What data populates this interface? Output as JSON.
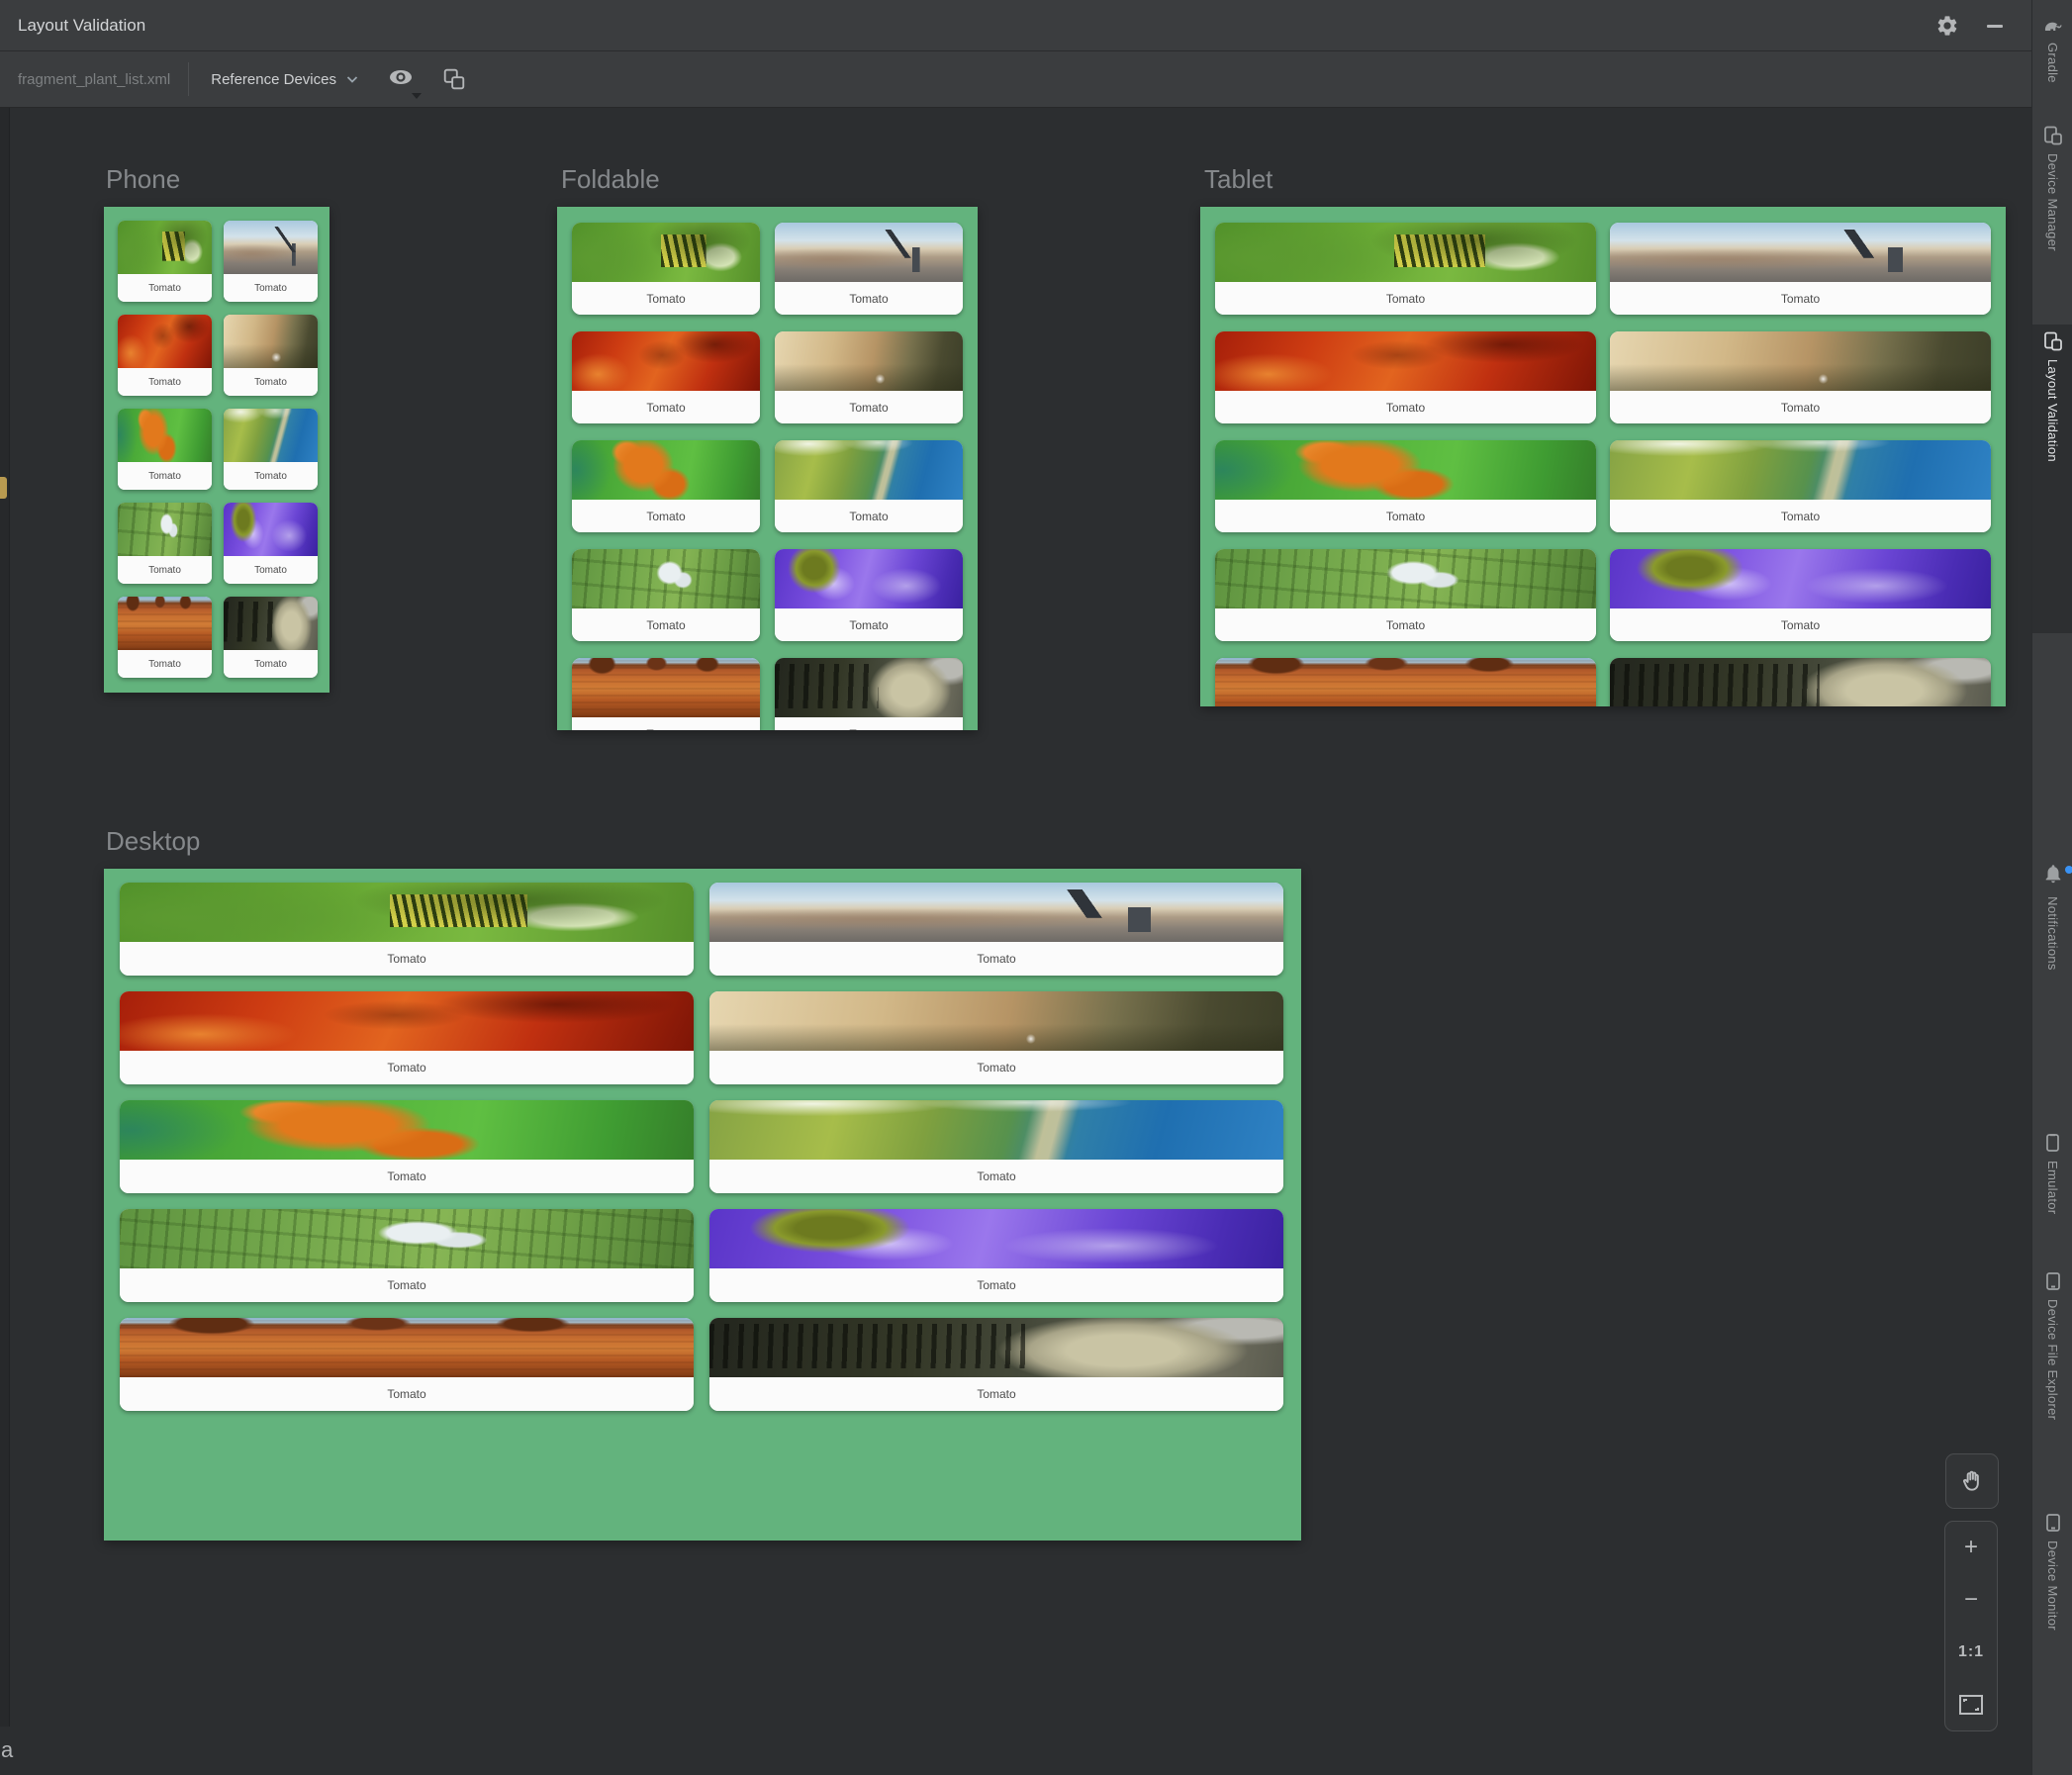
{
  "window": {
    "title": "Layout Validation"
  },
  "titlebar": {
    "icons": [
      "gear-icon",
      "minimize-icon"
    ]
  },
  "toolbar": {
    "file": "fragment_plant_list.xml",
    "device_set": "Reference Devices",
    "icons": [
      "chevron-down-icon",
      "visibility-eye-icon",
      "copy-screens-icon"
    ]
  },
  "panels": [
    {
      "label": "Phone"
    },
    {
      "label": "Foldable"
    },
    {
      "label": "Tablet"
    },
    {
      "label": "Desktop"
    }
  ],
  "cards": {
    "label": "Tomato",
    "images": [
      "caterpillar",
      "city-telescope",
      "red-maple-leaves",
      "wet-wood-branch",
      "orange-maple-leaf",
      "coastline-aerial",
      "farm-aerial",
      "purple-river",
      "desert-buttes",
      "dark-forest"
    ]
  },
  "sidebar": {
    "active_tab": "Layout Validation",
    "tabs": [
      {
        "label": "Gradle",
        "icon": "gradle-elephant-icon"
      },
      {
        "label": "Device Manager",
        "icon": "device-manager-icon"
      },
      {
        "label": "Layout Validation",
        "icon": "layout-validation-icon"
      },
      {
        "label": "Notifications",
        "icon": "notifications-bell-icon"
      },
      {
        "label": "Emulator",
        "icon": "emulator-icon"
      },
      {
        "label": "Device File Explorer",
        "icon": "device-file-explorer-icon"
      },
      {
        "label": "Device Monitor",
        "icon": "device-monitor-icon"
      }
    ]
  },
  "zoom_controls": {
    "pan": "pan-hand-icon",
    "plus": "+",
    "minus": "−",
    "one_to_one": "1:1",
    "fit": "fit-screen-icon"
  },
  "edge_fragment": "a",
  "colors": {
    "panel_green": "#63b37d",
    "notification_dot": "#3a93f5",
    "background": "#2c2e30",
    "bar": "#3b3d3f"
  }
}
